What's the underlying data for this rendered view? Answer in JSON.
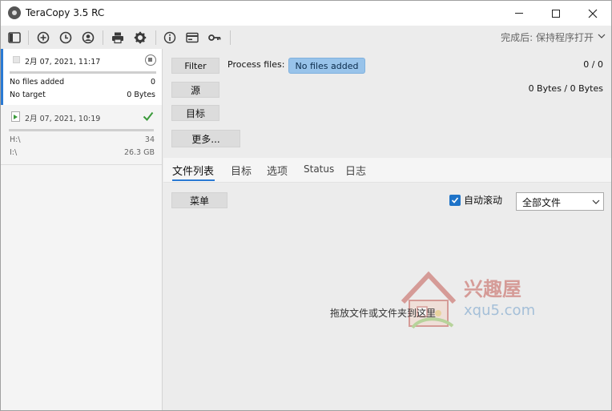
{
  "window": {
    "title": "TeraCopy 3.5 RC",
    "controls": {
      "minimize": "minimize",
      "maximize": "maximize",
      "close": "close"
    }
  },
  "toolbar": {
    "icons": [
      "panel-toggle-icon",
      "add-icon",
      "history-icon",
      "favorites-icon",
      "print-icon",
      "settings-icon",
      "info-icon",
      "card-icon",
      "key-icon"
    ],
    "after_completion": "完成后: 保持程序打开"
  },
  "jobs": [
    {
      "date": "2月 07, 2021, 11:17",
      "row1_label": "No files added",
      "row1_value": "0",
      "row2_label": "No target",
      "row2_value": "0 Bytes",
      "status": "stopped"
    },
    {
      "date": "2月 07, 2021, 10:19",
      "row1_label": "H:\\",
      "row1_value": "34",
      "row2_label": "I:\\",
      "row2_value": "26.3 GB",
      "status": "done"
    }
  ],
  "main": {
    "filter_button": "Filter",
    "source_button": "源",
    "target_button": "目标",
    "more_button": "更多...",
    "process_files_label": "Process files:",
    "no_files_badge": "No files added",
    "count": "0 / 0",
    "bytes": "0 Bytes / 0 Bytes"
  },
  "tabs": [
    {
      "label": "文件列表",
      "active": true
    },
    {
      "label": "目标",
      "active": false
    },
    {
      "label": "选项",
      "active": false
    },
    {
      "label": "Status",
      "active": false
    },
    {
      "label": "日志",
      "active": false
    }
  ],
  "filelist": {
    "menu_button": "菜单",
    "autoscroll_label": "自动滚动",
    "autoscroll_checked": true,
    "view_select_value": "全部文件",
    "drop_hint": "拖放文件或文件夹到这里"
  },
  "watermark": {
    "text_cn": "兴趣屋",
    "text_en": "xqu5.com"
  },
  "colors": {
    "accent": "#2a7ad4",
    "badge_bg": "#98c3ea",
    "success": "#3a9a3a"
  }
}
